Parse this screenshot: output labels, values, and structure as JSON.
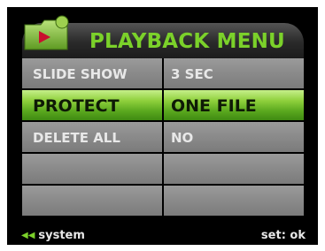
{
  "header": {
    "title": "PLAYBACK MENU",
    "icon": "playback-folder-icon"
  },
  "menu": {
    "rows": [
      {
        "label": "SLIDE SHOW",
        "value": "3 SEC",
        "selected": false
      },
      {
        "label": "PROTECT",
        "value": "ONE FILE",
        "selected": true
      },
      {
        "label": "DELETE ALL",
        "value": "NO",
        "selected": false
      },
      {
        "label": "",
        "value": "",
        "selected": false
      },
      {
        "label": "",
        "value": "",
        "selected": false
      }
    ]
  },
  "footer": {
    "left_icon": "double-left-arrow-icon",
    "left_label": "system",
    "right_label": "set: ok"
  },
  "colors": {
    "accent_green": "#7bd12a",
    "row_gray": "#8a8a8a",
    "background": "#000000"
  }
}
